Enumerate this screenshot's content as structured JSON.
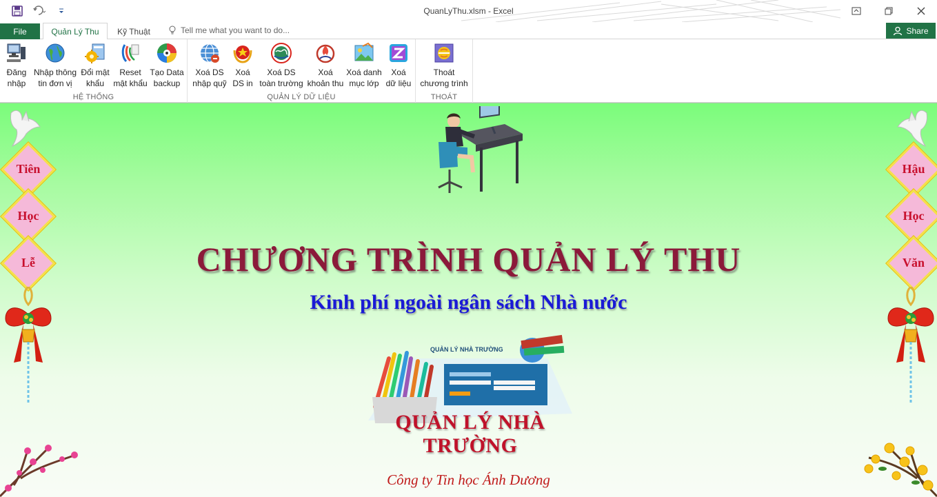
{
  "window": {
    "title": "QuanLyThu.xlsm - Excel"
  },
  "tabs": {
    "file": "File",
    "quanlythu": "Quản Lý Thu",
    "kythuat": "Kỹ Thuật",
    "tellme": "Tell me what you want to do...",
    "share": "Share"
  },
  "ribbon": {
    "groups": {
      "hethong": "HỆ THỐNG",
      "quanlydulieu": "QUẢN LÝ DỮ LIỆU",
      "thoat": "THOÁT"
    },
    "buttons": {
      "dangnhap": {
        "l1": "Đăng",
        "l2": "nhập",
        "icon": "computer-login-icon"
      },
      "nhapthongtin": {
        "l1": "Nhập thông",
        "l2": "tin đơn vị",
        "icon": "globe-icon"
      },
      "doimatkhau": {
        "l1": "Đổi mật",
        "l2": "khẩu",
        "icon": "password-change-icon"
      },
      "resetmatkhau": {
        "l1": "Reset",
        "l2": "mật khẩu",
        "icon": "reset-icon"
      },
      "taodatabackup": {
        "l1": "Tạo Data",
        "l2": "backup",
        "icon": "disc-backup-icon"
      },
      "xoadsnhapquy": {
        "l1": "Xoá DS",
        "l2": "nhập quỹ",
        "icon": "globe-network-icon"
      },
      "xoadsin": {
        "l1": "Xoá",
        "l2": "DS in",
        "icon": "emblem-icon"
      },
      "xoadstoantruong": {
        "l1": "Xoá DS",
        "l2": "toàn trường",
        "icon": "world-emblem-icon"
      },
      "xoakhoanthu": {
        "l1": "Xoá",
        "l2": "khoản thu",
        "icon": "flame-emblem-icon"
      },
      "xoadanhmuclop": {
        "l1": "Xoá danh",
        "l2": "mục lớp",
        "icon": "picture-icon"
      },
      "xoadulieu": {
        "l1": "Xoá",
        "l2": "dữ liệu",
        "icon": "z-letter-icon"
      },
      "thoatchuongtrinh": {
        "l1": "Thoát",
        "l2": "chương trình",
        "icon": "exit-icon"
      }
    }
  },
  "sheet": {
    "title": "CHƯƠNG TRÌNH QUẢN LÝ THU",
    "subtitle": "Kinh phí ngoài ngân sách Nhà nước",
    "banner_text": "QUẢN LÝ NHÀ TRƯỜNG",
    "company": "Công ty Tin học Ánh Dương",
    "left_couplet": [
      "Tiên",
      "Học",
      "Lễ"
    ],
    "right_couplet": [
      "Hậu",
      "Học",
      "Văn"
    ]
  },
  "colors": {
    "excel_green": "#217346",
    "title_color": "#8b1a3a",
    "subtitle_color": "#1a1ad6",
    "company_color": "#c01a1a"
  }
}
